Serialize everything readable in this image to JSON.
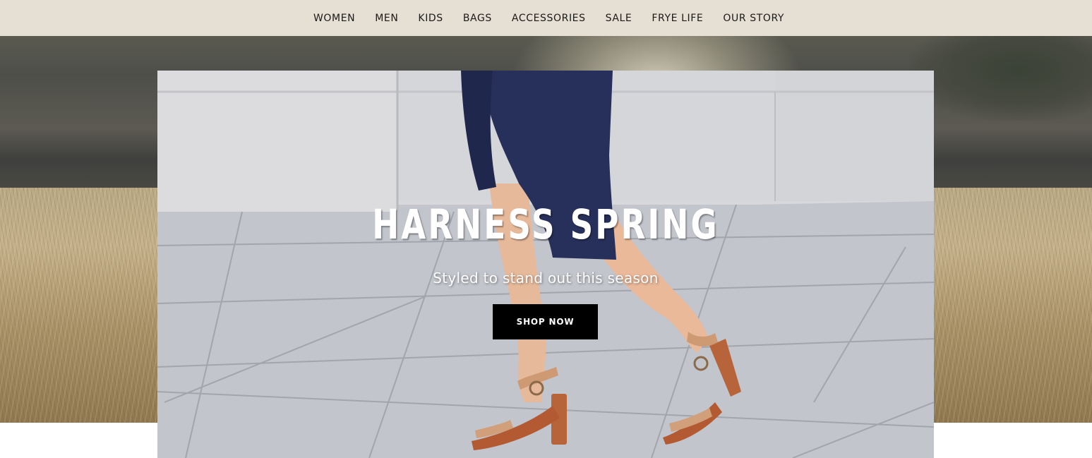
{
  "nav": {
    "items": [
      {
        "label": "WOMEN"
      },
      {
        "label": "MEN"
      },
      {
        "label": "KIDS"
      },
      {
        "label": "BAGS"
      },
      {
        "label": "ACCESSORIES"
      },
      {
        "label": "SALE"
      },
      {
        "label": "FRYE LIFE"
      },
      {
        "label": "OUR STORY"
      }
    ]
  },
  "hero": {
    "headline": "HARNESS SPRING",
    "subheadline": "Styled to stand out this season",
    "cta_label": "SHOP NOW"
  },
  "colors": {
    "nav_background": "#e6dfd3",
    "cta_background": "#000000",
    "cta_text": "#ffffff",
    "dress": "#27305a",
    "sandal": "#c89870"
  }
}
